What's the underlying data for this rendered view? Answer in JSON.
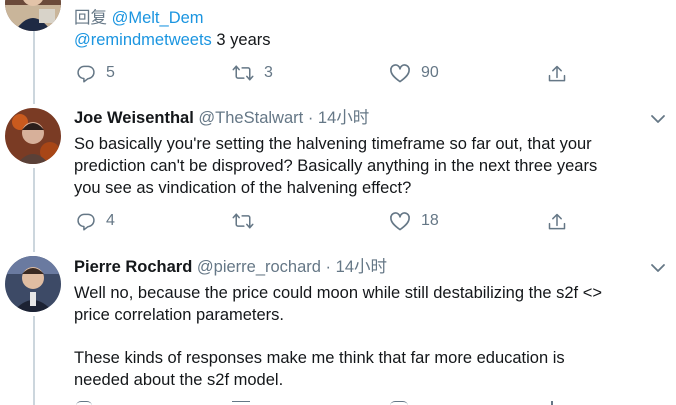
{
  "colors": {
    "link": "#1b95e0",
    "secondary": "#657786",
    "thread_line": "#ccd6dd"
  },
  "tweets": [
    {
      "reply_prefix": "回复",
      "reply_to": "@Melt_Dem",
      "mention": "@remindmetweets",
      "text_rest": " 3 years",
      "actions": {
        "reply_count": "5",
        "retweet_count": "3",
        "like_count": "90",
        "share_icon": "share-icon"
      }
    },
    {
      "name": "Joe Weisenthal",
      "handle": "@TheStalwart",
      "separator": "·",
      "time": "14小时",
      "lines": [
        "So basically you're setting the halvening timeframe so far out, that your",
        "prediction can't be disproved? Basically anything in the next three years",
        "you see as vindication of the halvening effect?"
      ],
      "actions": {
        "reply_count": "4",
        "retweet_count": "",
        "like_count": "18",
        "share_icon": "share-icon"
      }
    },
    {
      "name": "Pierre Rochard",
      "handle": "@pierre_rochard",
      "separator": "·",
      "time": "14小时",
      "lines": [
        "Well no, because the price could moon while still destabilizing the s2f <>",
        "price correlation parameters.",
        "",
        "These kinds of responses make me think that far more education is",
        "needed about the s2f model."
      ]
    }
  ]
}
